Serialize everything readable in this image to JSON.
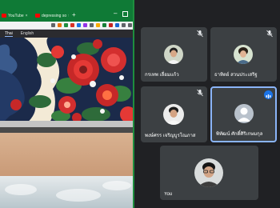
{
  "browser": {
    "tabs": [
      {
        "label": "YouTube",
        "close": "×"
      },
      {
        "label": "depressing so",
        "close": "×"
      }
    ],
    "new_tab": "+",
    "lang_tabs": [
      "Thai",
      "English"
    ]
  },
  "meeting": {
    "participants": [
      {
        "name": "กรเทพ เลื่อมแก้ว",
        "muted": true
      },
      {
        "name": "ธาทิตย์ สวนประเสริฐ",
        "muted": true
      },
      {
        "name": "พงษ์ศรร เจริญบูรโณภาส",
        "muted": true
      },
      {
        "name": "พิทัฒน์ ศักดิ์ศิริเกษมกุล",
        "speaking": true
      },
      {
        "name": "You",
        "self": true
      }
    ]
  },
  "colors": {
    "background": "#202124",
    "tile": "#3c4043",
    "active_border": "#8ab4f8",
    "speaking_badge": "#1a73e8",
    "tabbar_green": "#0f7a36"
  }
}
